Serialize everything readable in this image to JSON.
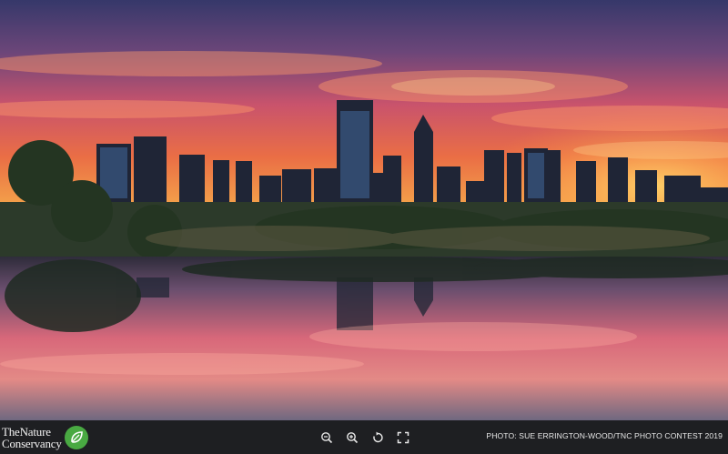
{
  "photo": {
    "subject": "Perth city skyline at sunset reflected in a lake",
    "sky_colors": [
      "#3b3a6e",
      "#7a4a7e",
      "#d8566a",
      "#f07a3c",
      "#f6b04a"
    ],
    "water_colors": [
      "#4f4a6a",
      "#c85a6e",
      "#e58a8a",
      "#8a7a9a"
    ]
  },
  "branding": {
    "logo_line1": "TheNature",
    "logo_line2": "Conservancy",
    "logo_icon": "leaf-globe-icon",
    "accent": "#49a942"
  },
  "toolbar": {
    "zoom_out_icon": "zoom-out-icon",
    "zoom_in_icon": "zoom-in-icon",
    "rotate_icon": "rotate-icon",
    "fullscreen_icon": "fullscreen-icon"
  },
  "credit": {
    "text": "PHOTO: SUE ERRINGTON-WOOD/TNC PHOTO CONTEST 2019"
  }
}
